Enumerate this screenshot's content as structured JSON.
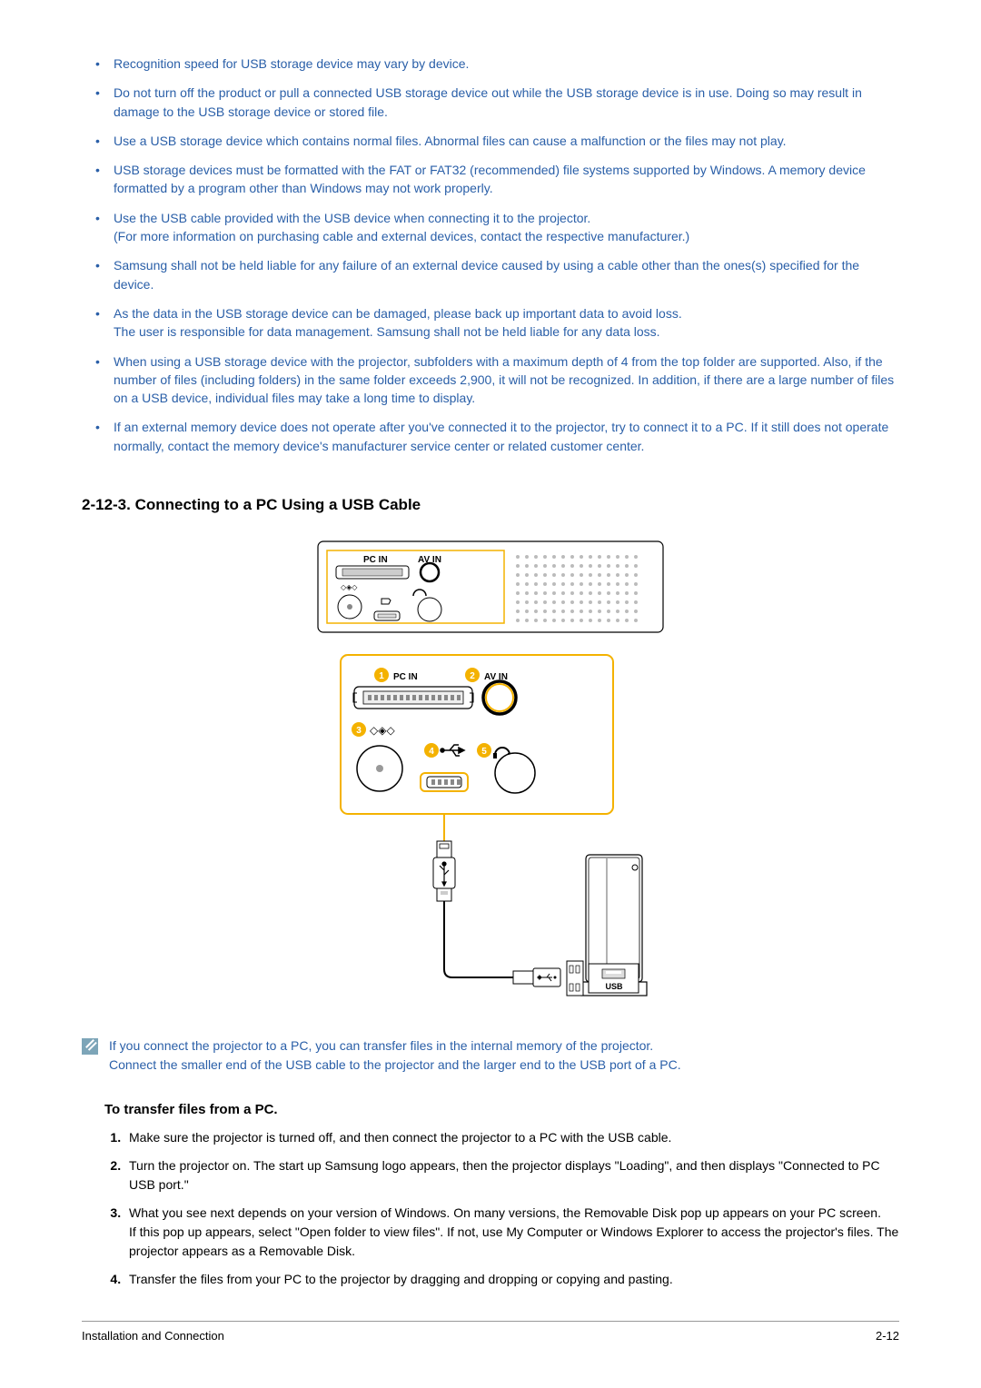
{
  "notices": [
    "Recognition speed for USB storage device may vary by device.",
    "Do not turn off the product or pull a connected USB storage device out while the USB storage device is in use. Doing so may result in damage to the USB storage device or stored file.",
    "Use a USB storage device which contains normal files. Abnormal files can cause a malfunction or the files may not play.",
    "USB storage devices must be formatted with the FAT or FAT32 (recommended) file systems supported by Windows. A memory device formatted by a program other than Windows may not work properly.",
    "Use the USB cable provided with the USB device when connecting it to the projector.\n(For more information on purchasing cable and external devices, contact the respective manufacturer.)",
    "Samsung shall not be held liable for any failure of an external device caused by using a cable other than the ones(s) specified for the device.",
    "As the data in the USB storage device can be damaged, please back up important data to avoid loss.\nThe user is responsible for data management. Samsung shall not be held liable for any data loss.",
    "When using a USB storage device with the projector, subfolders with a maximum depth of 4 from the top folder are supported. Also, if the number of files (including folders) in the same folder exceeds 2,900, it will not be recognized. In addition, if there are a large number of files on a USB device, individual files may take a long time to display.",
    "If an external memory device does not operate after you've connected it to the projector, try to connect it to a PC. If it still does not operate normally, contact the memory device's manufacturer service center or related customer center."
  ],
  "section_title": "2-12-3. Connecting to a PC Using a USB Cable",
  "diagram": {
    "top_labels": {
      "pc_in": "PC IN",
      "av_in": "AV IN"
    },
    "zoom_labels": {
      "pc_in": "PC IN",
      "av_in": "AV IN"
    },
    "pc_usb_label": "USB"
  },
  "note": "If you connect the projector to a PC, you can transfer files in the internal memory of the projector.\nConnect the smaller end of the USB cable to the projector and the larger end to the USB port of a PC.",
  "sub_heading": "To transfer files from a PC.",
  "steps": [
    "Make sure the projector is turned off, and then connect the projector to a PC with the USB cable.",
    "Turn the projector on. The start up Samsung logo appears, then the projector displays \"Loading\", and then displays \"Connected to PC USB port.\"",
    "What you see next depends on your version of Windows. On many versions, the Removable Disk pop up appears on your PC screen.\nIf this pop up appears, select \"Open folder to view files\". If not, use My Computer or Windows Explorer to access the projector's files. The projector appears as a Removable Disk.",
    "Transfer the files from your PC to the projector by dragging and dropping or copying and pasting."
  ],
  "footer": {
    "left": "Installation and Connection",
    "right": "2-12"
  }
}
